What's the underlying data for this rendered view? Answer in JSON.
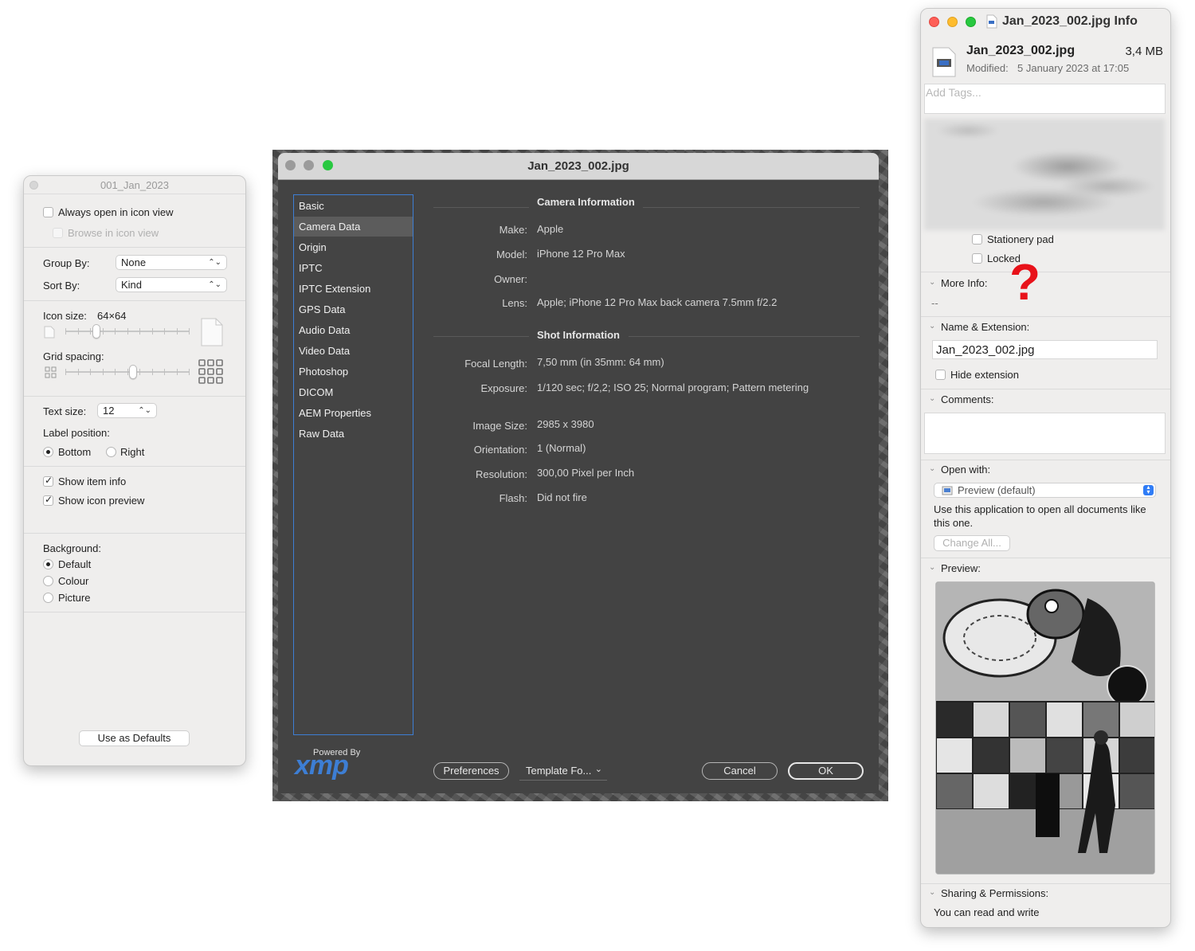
{
  "view_options": {
    "title": "001_Jan_2023",
    "always_open_label": "Always open in icon view",
    "browse_label": "Browse in icon view",
    "group_by_label": "Group By:",
    "group_by_value": "None",
    "sort_by_label": "Sort By:",
    "sort_by_value": "Kind",
    "icon_size_label": "Icon size:",
    "icon_size_value": "64×64",
    "grid_spacing_label": "Grid spacing:",
    "text_size_label": "Text size:",
    "text_size_value": "12",
    "label_position_label": "Label position:",
    "bottom_label": "Bottom",
    "right_label": "Right",
    "show_item_info_label": "Show item info",
    "show_icon_preview_label": "Show icon preview",
    "background_label": "Background:",
    "bg_default_label": "Default",
    "bg_colour_label": "Colour",
    "bg_picture_label": "Picture",
    "use_defaults_label": "Use as Defaults",
    "icon_size_fraction": 0.23,
    "grid_spacing_fraction": 0.55
  },
  "xmp": {
    "title": "Jan_2023_002.jpg",
    "nav_items": [
      "Basic",
      "Camera Data",
      "Origin",
      "IPTC",
      "IPTC Extension",
      "GPS Data",
      "Audio Data",
      "Video Data",
      "Photoshop",
      "DICOM",
      "AEM Properties",
      "Raw Data"
    ],
    "camera_section": "Camera Information",
    "make_label": "Make:",
    "make_value": "Apple",
    "model_label": "Model:",
    "model_value": "iPhone 12 Pro Max",
    "owner_label": "Owner:",
    "lens_label": "Lens:",
    "lens_value": "Apple;   iPhone 12 Pro Max back camera 7.5mm f/2.2",
    "shot_section": "Shot Information",
    "focal_label": "Focal Length:",
    "focal_value": "7,50 mm   (in 35mm: 64 mm)",
    "exposure_label": "Exposure:",
    "exposure_value": "1/120 sec;   f/2,2;   ISO 25;   Normal program;   Pattern metering",
    "image_size_label": "Image Size:",
    "image_size_value": "2985 x 3980",
    "orientation_label": "Orientation:",
    "orientation_value": "1 (Normal)",
    "resolution_label": "Resolution:",
    "resolution_value": "300,00 Pixel per Inch",
    "flash_label": "Flash:",
    "flash_value": "Did not fire",
    "powered_by": "Powered By",
    "logo_text": "xmp",
    "preferences_label": "Preferences",
    "template_label": "Template Fo...",
    "cancel_label": "Cancel",
    "ok_label": "OK"
  },
  "info": {
    "title": "Jan_2023_002.jpg Info",
    "file_name": "Jan_2023_002.jpg",
    "file_size": "3,4 MB",
    "modified_label": "Modified:",
    "modified_value": "5 January 2023 at 17:05",
    "tags_placeholder": "Add Tags...",
    "stationery_label": "Stationery pad",
    "locked_label": "Locked",
    "more_info_label": "More Info:",
    "question_mark": "?",
    "more_info_value": "--",
    "name_ext_label": "Name & Extension:",
    "name_value": "Jan_2023_002.jpg",
    "hide_ext_label": "Hide extension",
    "comments_label": "Comments:",
    "open_with_label": "Open with:",
    "open_with_value": "Preview (default)",
    "open_with_note": "Use this application to open all documents like this one.",
    "change_all_label": "Change All...",
    "preview_label": "Preview:",
    "sharing_label": "Sharing & Permissions:",
    "sharing_value": "You can read and write"
  },
  "colors": {
    "close": "#fe5f57",
    "minimize": "#febc2e",
    "zoom": "#28c840",
    "xmp_accent": "#3d7ed4",
    "question_red": "#e8121a"
  }
}
